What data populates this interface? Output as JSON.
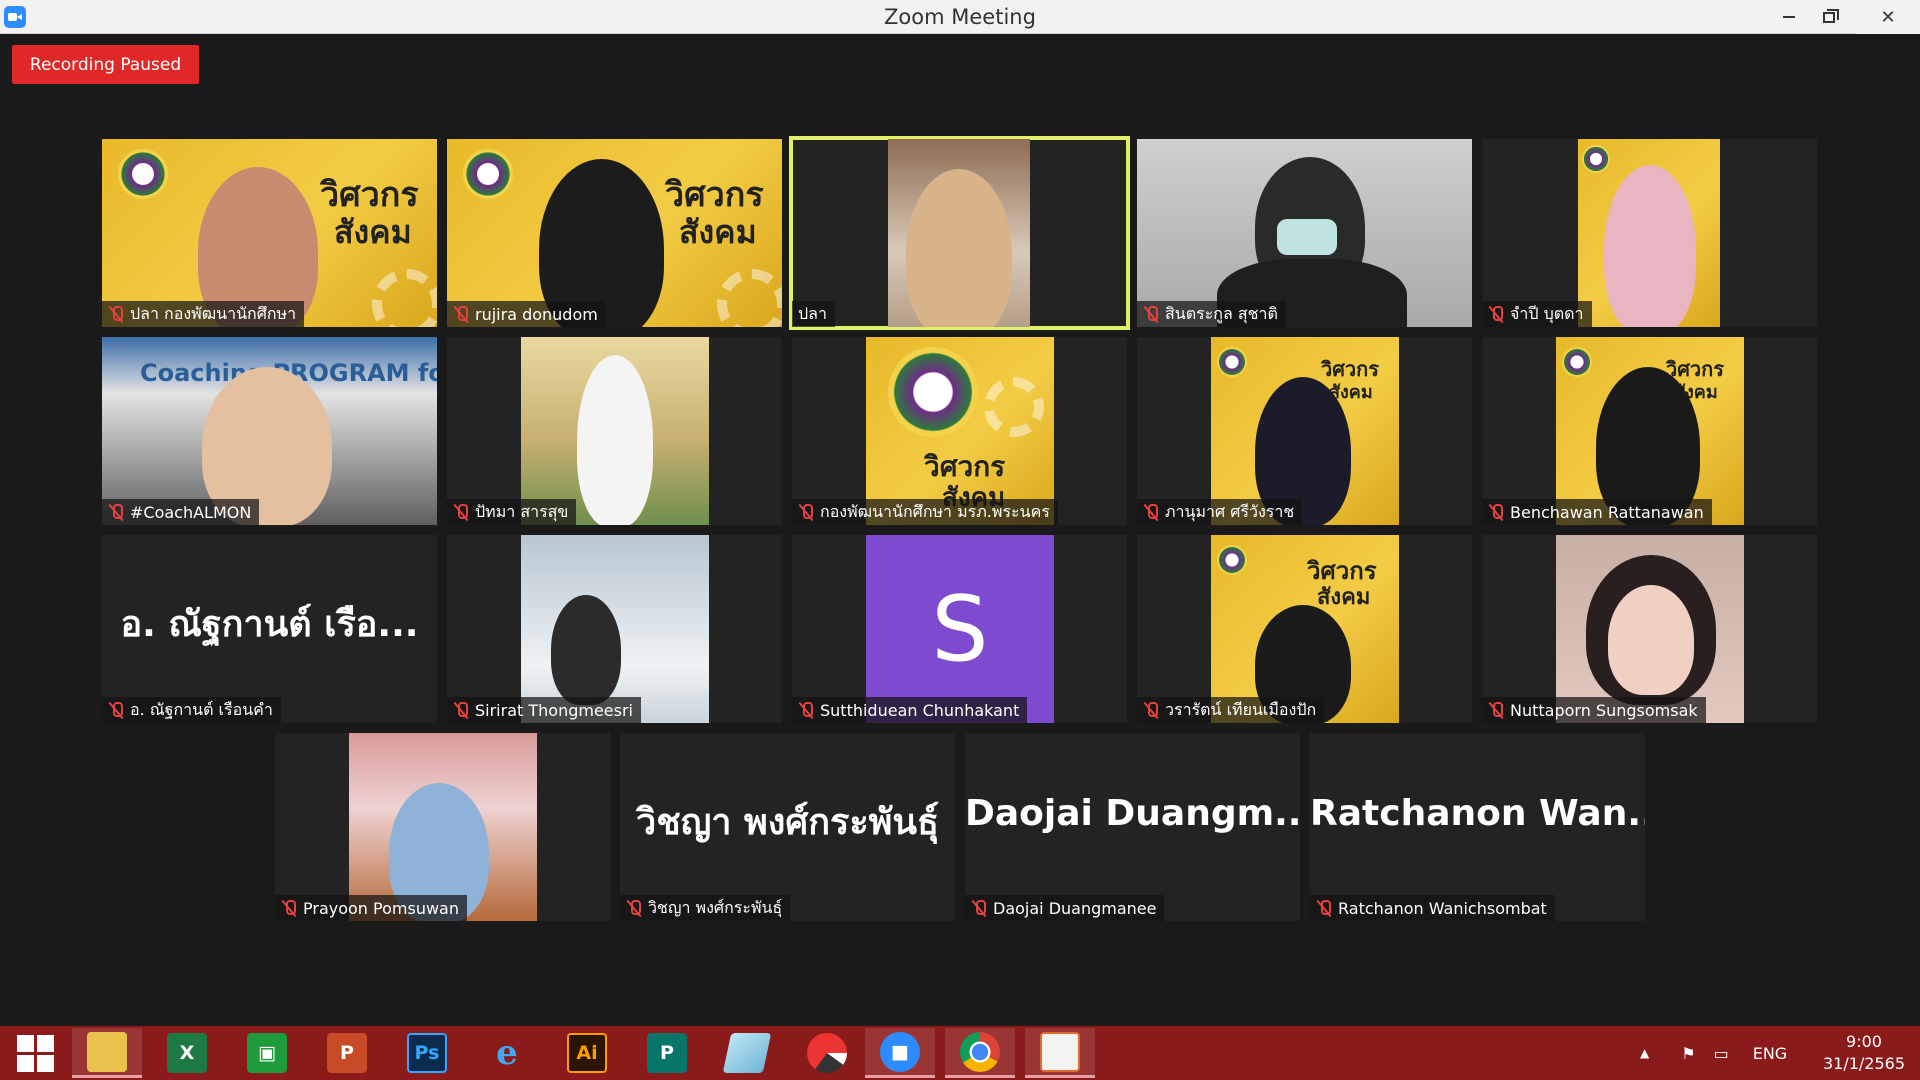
{
  "window": {
    "title": "Zoom Meeting"
  },
  "recording": {
    "label": "Recording Paused"
  },
  "participants": [
    {
      "display": "ปลา กองพัฒนานักศึกษา",
      "muted": true
    },
    {
      "display": "rujira donudom",
      "muted": true
    },
    {
      "display": "ปลา",
      "muted": false,
      "active_speaker": true
    },
    {
      "display": "สินตระกูล สุชาติ",
      "muted": true
    },
    {
      "display": "จำปี บุตดา",
      "muted": true
    },
    {
      "display": "#CoachALMON",
      "muted": true
    },
    {
      "display": "ปัทมา สารสุข",
      "muted": true
    },
    {
      "display": "กองพัฒนานักศึกษา มรภ.พระนคร",
      "muted": true
    },
    {
      "display": "ภานุมาศ ศรีวังราช",
      "muted": true
    },
    {
      "display": "Benchawan Rattanawan",
      "muted": true
    },
    {
      "display": "อ. ณัฐกานต์ เรือนคำ",
      "big_name": "อ. ณัฐกานต์ เรือ...",
      "muted": true
    },
    {
      "display": "Sirirat Thongmeesri",
      "muted": true
    },
    {
      "display": "Sutthiduean Chunhakant",
      "avatar_letter": "S",
      "muted": true
    },
    {
      "display": "วรารัตน์ เทียนเมืองปัก",
      "muted": true
    },
    {
      "display": "Nuttaporn Sungsomsak",
      "muted": true
    },
    {
      "display": "Prayoon Pomsuwan",
      "muted": true
    },
    {
      "display": "วิชญา พงศ์กระพันธุ์",
      "big_name": "วิชญา พงศ์กระพันธุ์",
      "muted": true
    },
    {
      "display": "Daojai Duangmanee",
      "big_name": "Daojai  Duangm...",
      "muted": true
    },
    {
      "display": "Ratchanon Wanichsombat",
      "big_name": "Ratchanon  Wan...",
      "muted": true
    }
  ],
  "banner": {
    "word1": "วิศวกร",
    "word2": "สังคม"
  },
  "coach_slide": {
    "text": "Coaching PROGRAM for Leader"
  },
  "taskbar": {
    "apps": [
      "start-menu",
      "file-explorer",
      "excel",
      "store",
      "powerpoint",
      "photoshop",
      "internet-explorer",
      "illustrator",
      "publisher",
      "notepad",
      "photoscape",
      "zoom",
      "chrome",
      "paint"
    ],
    "labels": {
      "excel": "X",
      "powerpoint": "P",
      "photoshop": "Ps",
      "illustrator": "Ai",
      "publisher": "P"
    },
    "language": "ENG",
    "time": "9:00",
    "date": "31/1/2565"
  },
  "colors": {
    "taskbar": "#8b1a1a",
    "recording": "#e02828",
    "active_border": "#e1f066",
    "avatar": "#7e4bd0"
  }
}
